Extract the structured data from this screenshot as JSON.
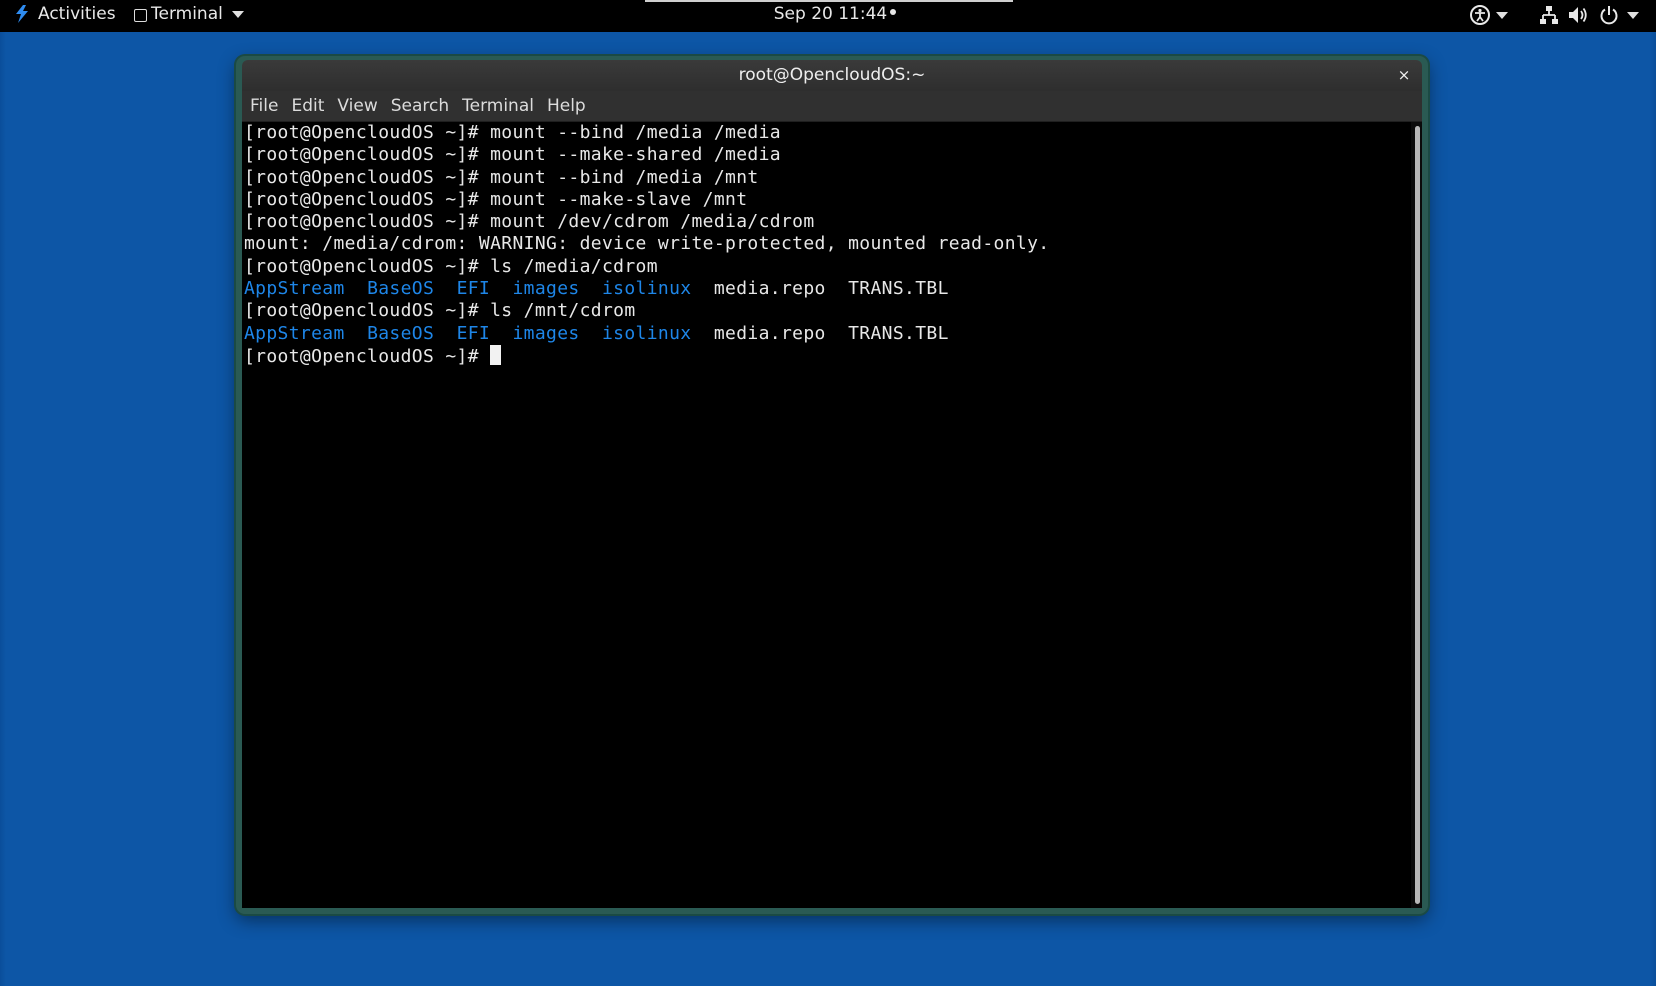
{
  "topbar": {
    "activities": "Activities",
    "app_menu": "Terminal",
    "clock": "Sep 20  11:44",
    "icons": {
      "logo": "opencloudos-logo-icon",
      "accessibility": "accessibility-icon",
      "network": "network-wired-icon",
      "volume": "volume-icon",
      "power": "power-icon"
    }
  },
  "window": {
    "title": "root@OpencloudOS:~",
    "close_glyph": "×",
    "menu": [
      "File",
      "Edit",
      "View",
      "Search",
      "Terminal",
      "Help"
    ]
  },
  "terminal": {
    "prompt": "[root@OpencloudOS ~]# ",
    "lines": [
      {
        "type": "cmd",
        "text": "mount --bind /media /media"
      },
      {
        "type": "cmd",
        "text": "mount --make-shared /media"
      },
      {
        "type": "cmd",
        "text": "mount --bind /media /mnt"
      },
      {
        "type": "cmd",
        "text": "mount --make-slave /mnt"
      },
      {
        "type": "cmd",
        "text": "mount /dev/cdrom /media/cdrom"
      },
      {
        "type": "out",
        "text": "mount: /media/cdrom: WARNING: device write-protected, mounted read-only."
      },
      {
        "type": "cmd",
        "text": "ls /media/cdrom"
      },
      {
        "type": "ls",
        "dirs": [
          "AppStream",
          "BaseOS",
          "EFI",
          "images",
          "isolinux"
        ],
        "files": [
          "media.repo",
          "TRANS.TBL"
        ]
      },
      {
        "type": "cmd",
        "text": "ls /mnt/cdrom"
      },
      {
        "type": "ls",
        "dirs": [
          "AppStream",
          "BaseOS",
          "EFI",
          "images",
          "isolinux"
        ],
        "files": [
          "media.repo",
          "TRANS.TBL"
        ]
      },
      {
        "type": "cmd",
        "text": "",
        "cursor": true
      }
    ]
  },
  "colors": {
    "desktop": "#0d56a6",
    "directory": "#1e86e8",
    "terminal_fg": "#e8e8e8",
    "terminal_bg": "#000000"
  }
}
